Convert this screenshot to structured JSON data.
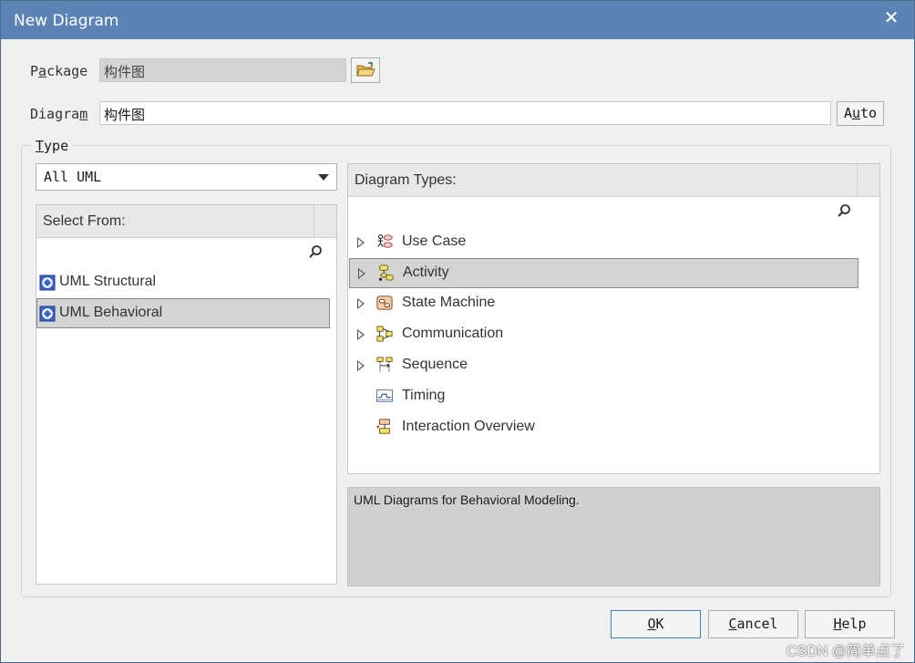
{
  "window": {
    "title": "New Diagram",
    "close_glyph": "✕"
  },
  "package": {
    "label_pre": "P",
    "label_ul": "a",
    "label_post": "ckage",
    "value": "构件图"
  },
  "diagram": {
    "label_pre": "Diagra",
    "label_ul": "m",
    "label_post": "",
    "value": "构件图",
    "auto_pre": "A",
    "auto_ul": "u",
    "auto_post": "to"
  },
  "type_group": {
    "label_pre": "",
    "label_ul": "T",
    "label_post": "ype"
  },
  "filter_combo": {
    "value": "All UML"
  },
  "select_from": {
    "header": "Select From:",
    "items": [
      {
        "label": "UML Structural",
        "selected": false,
        "icon": "uml-package-icon"
      },
      {
        "label": "UML Behavioral",
        "selected": true,
        "icon": "uml-package-icon"
      }
    ]
  },
  "diagram_types": {
    "header": "Diagram Types:",
    "items": [
      {
        "label": "Use Case",
        "expandable": true,
        "selected": false,
        "icon": "use-case-icon"
      },
      {
        "label": "Activity",
        "expandable": true,
        "selected": true,
        "icon": "activity-icon"
      },
      {
        "label": "State Machine",
        "expandable": true,
        "selected": false,
        "icon": "state-machine-icon"
      },
      {
        "label": "Communication",
        "expandable": true,
        "selected": false,
        "icon": "communication-icon"
      },
      {
        "label": "Sequence",
        "expandable": true,
        "selected": false,
        "icon": "sequence-icon"
      },
      {
        "label": "Timing",
        "expandable": false,
        "selected": false,
        "icon": "timing-icon"
      },
      {
        "label": "Interaction Overview",
        "expandable": false,
        "selected": false,
        "icon": "interaction-overview-icon"
      }
    ]
  },
  "description": "UML Diagrams for Behavioral Modeling.",
  "buttons": {
    "ok": {
      "pre": "",
      "ul": "O",
      "post": "K"
    },
    "cancel": {
      "pre": "",
      "ul": "C",
      "post": "ancel"
    },
    "help": {
      "pre": "",
      "ul": "H",
      "post": "elp"
    }
  },
  "watermark": "CSDN @简单点了",
  "colors": {
    "titlebar": "#5b84b4",
    "selection": "#d4d4d4",
    "description_bg": "#d0d0d0"
  }
}
